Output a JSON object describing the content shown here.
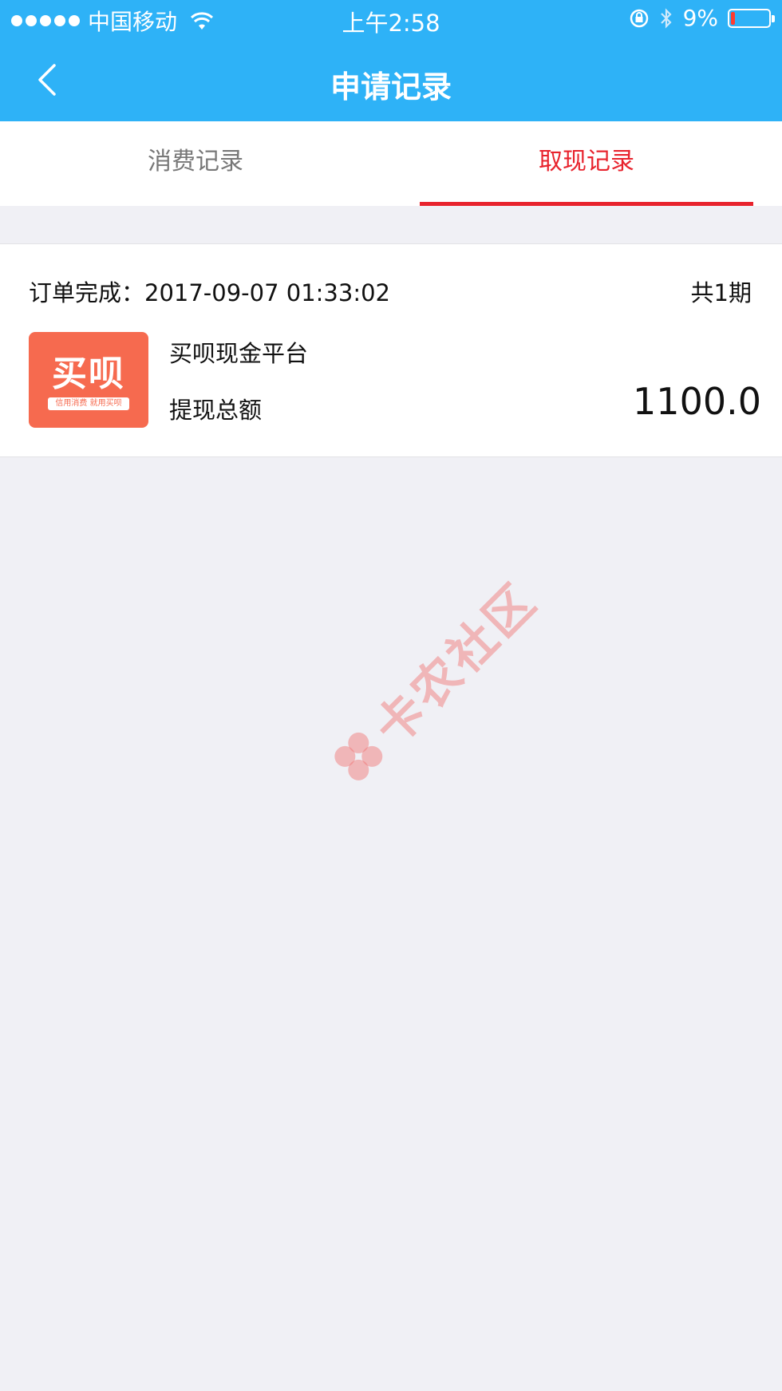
{
  "status_bar": {
    "carrier": "中国移动",
    "time": "上午2:58",
    "battery": "9%",
    "battery_level": 0.09
  },
  "nav": {
    "title": "申请记录"
  },
  "tabs": [
    {
      "label": "消费记录",
      "active": false
    },
    {
      "label": "取现记录",
      "active": true
    }
  ],
  "record": {
    "order_label": "订单完成：2017-09-07 01:33:02",
    "periods": "共1期",
    "logo_text": "买呗",
    "logo_subtext": "信用消费 就用买呗",
    "platform": "买呗现金平台",
    "total_label": "提现总额",
    "amount": "1100.0"
  },
  "watermark": "卡农社区",
  "colors": {
    "header": "#2eb2f7",
    "active_tab": "#e8232d",
    "logo_bg": "#f66a4f"
  }
}
